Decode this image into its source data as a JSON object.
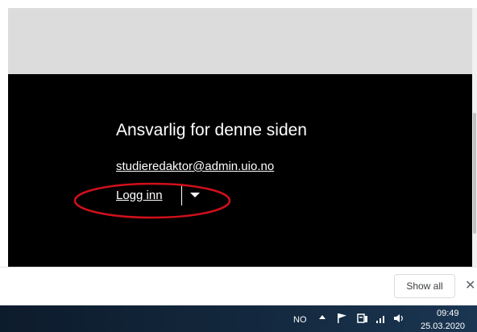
{
  "footer": {
    "heading": "Ansvarlig for denne siden",
    "email": "studieredaktor@admin.uio.no",
    "login_label": "Logg inn"
  },
  "downloads": {
    "show_all_label": "Show all",
    "close_label": "✕"
  },
  "taskbar": {
    "language": "NO",
    "time": "09:49",
    "date": "25.03.2020"
  },
  "icons": [
    "chevron-up-icon",
    "flag-icon",
    "network-icon",
    "signal-icon",
    "volume-icon",
    "chevron-down-icon",
    "close-icon"
  ],
  "colors": {
    "footer_bg": "#000000",
    "page_band": "#dcdcdc",
    "annotation": "#d0101a",
    "taskbar": "#142a40"
  }
}
